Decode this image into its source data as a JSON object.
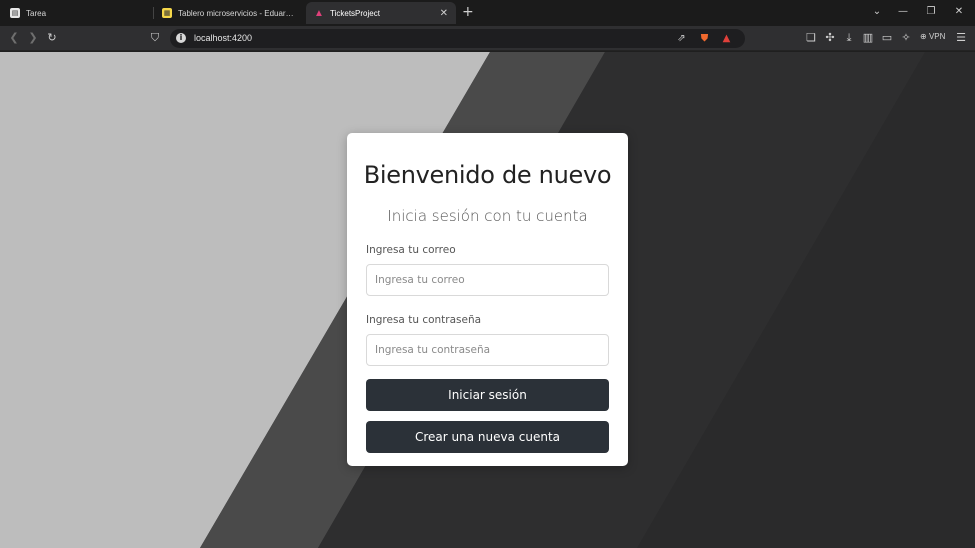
{
  "browser": {
    "tabs": [
      {
        "title": "Tarea",
        "icon": "notebook-icon"
      },
      {
        "title": "Tablero microservicios - Eduardo Sc",
        "icon": "board-icon"
      },
      {
        "title": "TicketsProject",
        "icon": "angular-icon",
        "active": true
      }
    ],
    "url": "localhost:4200",
    "vpn_label": "VPN"
  },
  "login": {
    "title": "Bienvenido de nuevo",
    "subtitle": "Inicia sesión con tu cuenta",
    "email_label": "Ingresa tu correo",
    "email_placeholder": "Ingresa tu correo",
    "email_value": "",
    "password_label": "Ingresa tu contraseña",
    "password_placeholder": "Ingresa tu contraseña",
    "password_value": "",
    "login_button": "Iniciar sesión",
    "register_button": "Crear una nueva cuenta"
  },
  "colors": {
    "button_bg": "#2b3138",
    "background_light": "#bdbdbd",
    "background_mid": "#4a4a4a",
    "background_dark": "#2a2a2b"
  }
}
